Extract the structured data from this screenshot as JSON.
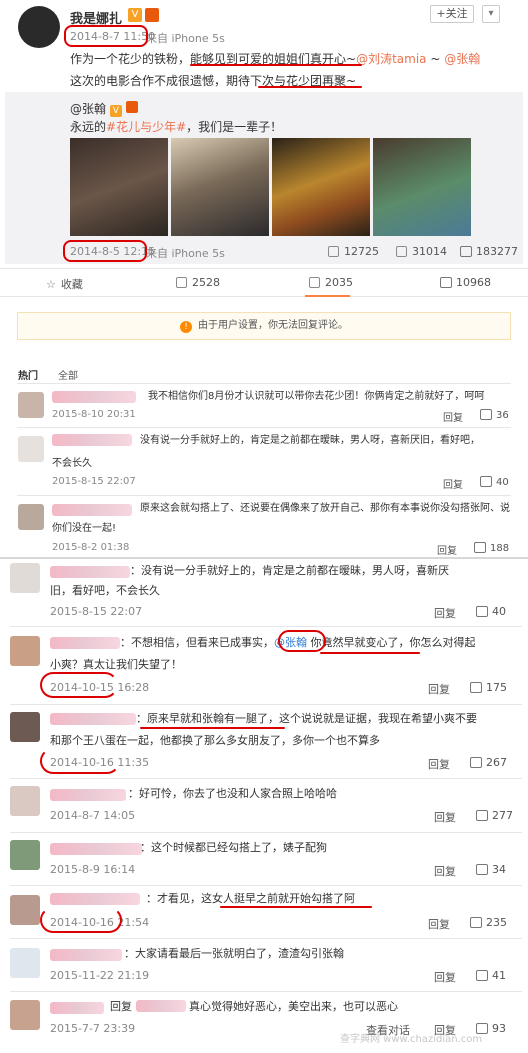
{
  "post": {
    "username": "我是娜扎",
    "follow": "+关注",
    "date": "2014-8-7 11:50",
    "source": "来自 iPhone 5s",
    "text1a": "作为一个花少的铁粉，",
    "text1b": "能够见到可爱的姐姐们真开心~",
    "mention1": "@刘涛tamia",
    "sep": " ~ ",
    "mention2": "@张翰",
    "text2a": "这次的电影合作不成很遗憾，期待",
    "text2b": "下次与花少团再聚~"
  },
  "repost": {
    "author": "@张翰",
    "text_a": "永远的",
    "hashtag": "#花儿与少年#",
    "text_b": "，我们是一辈子！",
    "date": "2014-8-5 12:15",
    "source": "来自 iPhone 5s",
    "stats": [
      "12725",
      "31014",
      "183277"
    ]
  },
  "actions": {
    "fav": "收藏",
    "repost": "2528",
    "comment": "2035",
    "like": "10968"
  },
  "notice": "由于用户设置，你无法回复评论。",
  "tabs": [
    "热门",
    "全部"
  ],
  "reply_label": "回复",
  "comments_a": [
    {
      "text": "我不相信你们8月份才认识就可以带你去花少团！你俩肯定之前就好了，呵呵",
      "date": "2015-8-10 20:31",
      "likes": "36"
    },
    {
      "text": "没有说一分手就好上的，肯定是之前都在暧昧，男人呀，喜新厌旧，看好吧，",
      "text2": "不会长久",
      "date": "2015-8-15 22:07",
      "likes": "40"
    },
    {
      "text": "原来这会就勾搭上了、还说要在偶像来了放开自己、那你有本事说你没勾搭张阿、说",
      "text2": "你们没在一起!",
      "date": "2015-8-2 01:38",
      "likes": "188"
    }
  ],
  "comments_b": [
    {
      "text": "：没有说一分手就好上的，肯定是之前都在暧昧，男人呀，喜新厌",
      "text2": "旧，看好吧，不会长久",
      "date": "2015-8-15 22:07",
      "likes": "40"
    },
    {
      "text_a": "：不想相信，但看来已成事实，",
      "mention": "@张翰",
      "text_b": "你竟然早就变心了",
      "text_c": "，你怎么对得起",
      "text2": "小爽？真太让我们失望了！",
      "date": "2014-10-15 16:28",
      "likes": "175"
    },
    {
      "text_a": "：",
      "text_b": "原来早就和张翰有一腿了",
      "text_c": "，这个说说就是证据，我现在希望小爽不要",
      "text2": "和那个王八蛋在一起，他都换了那么多女朋友了，多你一个也不算多",
      "date": "2014-10-16 11:35",
      "likes": "267"
    },
    {
      "text": "：好可怜，你去了也没和人家合照上哈哈哈",
      "date": "2014-8-7 14:05",
      "likes": "277"
    },
    {
      "text": "：这个时候都已经勾搭上了，婊子配狗",
      "date": "2015-8-9 16:14",
      "likes": "34"
    },
    {
      "text_a": "：才看见，这",
      "text_b": "女人挺早之前就开始勾搭了阿",
      "date": "2014-10-16 21:54",
      "likes": "235"
    },
    {
      "text": "：大家请看最后一张就明白了，渣渣勾引张翰",
      "date": "2015-11-22 21:19",
      "likes": "41"
    },
    {
      "text": "回复",
      "text_b": "真心觉得她好恶心，美空出来，也可以恶心",
      "date": "2015-7-7 23:39",
      "action": "查看对话",
      "likes": "93"
    }
  ],
  "watermark": "查字典网 www.chazidian.com"
}
